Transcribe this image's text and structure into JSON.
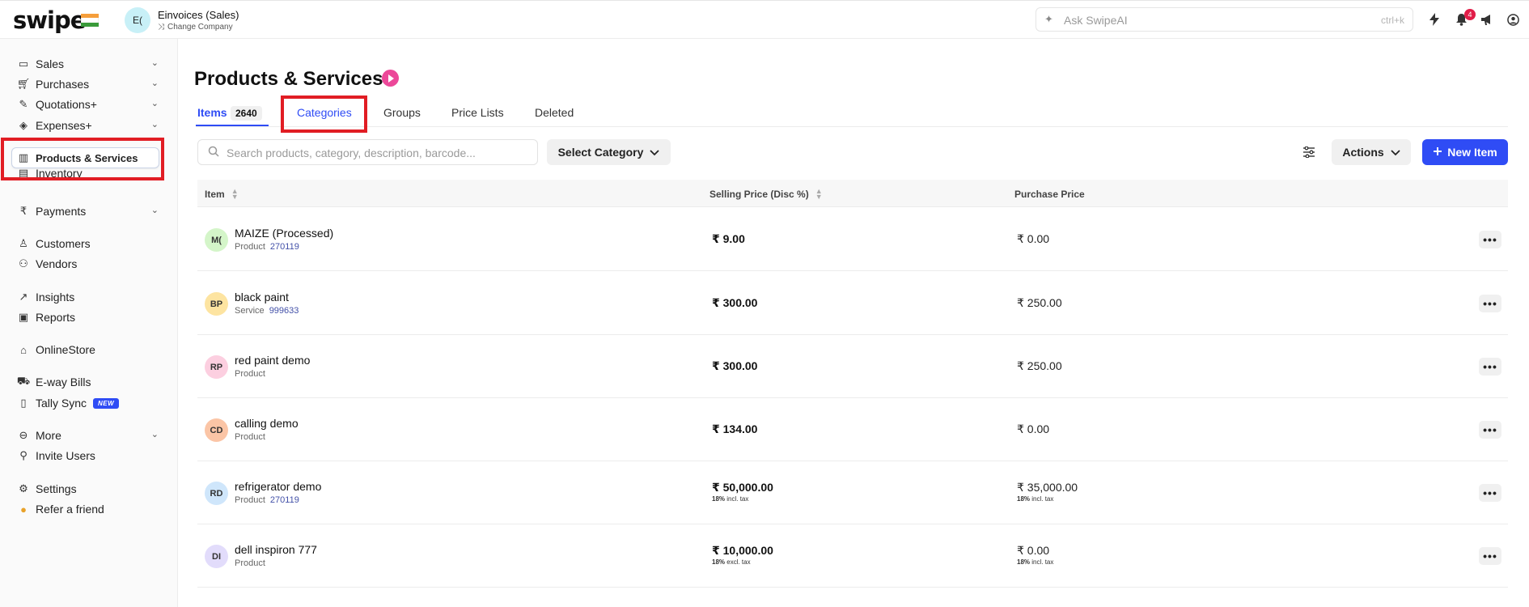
{
  "header": {
    "logo": "swipe",
    "company_avatar": "E(",
    "company_name": "Einvoices (Sales)",
    "change_company": "Change Company",
    "ai_search_placeholder": "Ask SwipeAI",
    "ai_search_shortcut": "ctrl+k",
    "notification_count": "4"
  },
  "sidebar": {
    "items": [
      {
        "label": "Sales",
        "icon": "cash-icon",
        "has_chevron": true
      },
      {
        "label": "Purchases",
        "icon": "cart-icon",
        "has_chevron": true
      },
      {
        "label": "Quotations+",
        "icon": "pen-icon",
        "has_chevron": true
      },
      {
        "label": "Expenses+",
        "icon": "tag-icon",
        "has_chevron": true
      },
      {
        "label": "Products & Services",
        "icon": "barcode-icon",
        "active": true
      },
      {
        "label": "Inventory",
        "icon": "chart-icon"
      },
      {
        "label": "Payments",
        "icon": "rupee-icon",
        "has_chevron": true
      },
      {
        "label": "Customers",
        "icon": "user-icon"
      },
      {
        "label": "Vendors",
        "icon": "users-icon"
      },
      {
        "label": "Insights",
        "icon": "trend-icon"
      },
      {
        "label": "Reports",
        "icon": "report-icon"
      },
      {
        "label": "OnlineStore",
        "icon": "store-icon"
      },
      {
        "label": "E-way Bills",
        "icon": "truck-icon"
      },
      {
        "label": "Tally Sync",
        "icon": "document-icon",
        "badge": "NEW"
      },
      {
        "label": "More",
        "icon": "more-circle-icon",
        "has_chevron": true
      },
      {
        "label": "Invite Users",
        "icon": "user-plus-icon"
      },
      {
        "label": "Settings",
        "icon": "gear-icon"
      },
      {
        "label": "Refer a friend",
        "icon": "handshake-icon"
      }
    ]
  },
  "main": {
    "title": "Products & Services",
    "tabs": [
      {
        "label": "Items",
        "count": "2640",
        "active": true
      },
      {
        "label": "Categories"
      },
      {
        "label": "Groups"
      },
      {
        "label": "Price Lists"
      },
      {
        "label": "Deleted"
      }
    ],
    "search_placeholder": "Search products, category, description, barcode...",
    "select_category": "Select Category",
    "actions": "Actions",
    "new_item": "New Item",
    "columns": {
      "item": "Item",
      "selling_price": "Selling Price (Disc %)",
      "purchase_price": "Purchase Price"
    },
    "rows": [
      {
        "initials": "M(",
        "avatar_color": "#d4f5c9",
        "name": "MAIZE (Processed)",
        "type": "Product",
        "code": "270119",
        "selling": "₹ 9.00",
        "selling_note": "",
        "purchase": "₹ 0.00",
        "purchase_note": ""
      },
      {
        "initials": "BP",
        "avatar_color": "#fde4a1",
        "name": "black paint",
        "type": "Service",
        "code": "999633",
        "selling": "₹ 300.00",
        "selling_note": "",
        "purchase": "₹ 250.00",
        "purchase_note": ""
      },
      {
        "initials": "RP",
        "avatar_color": "#fccfe0",
        "name": "red paint demo",
        "type": "Product",
        "code": "",
        "selling": "₹ 300.00",
        "selling_note": "",
        "purchase": "₹ 250.00",
        "purchase_note": ""
      },
      {
        "initials": "CD",
        "avatar_color": "#fbc5a6",
        "name": "calling demo",
        "type": "Product",
        "code": "",
        "selling": "₹ 134.00",
        "selling_note": "",
        "purchase": "₹ 0.00",
        "purchase_note": ""
      },
      {
        "initials": "RD",
        "avatar_color": "#cfe6fb",
        "name": "refrigerator demo",
        "type": "Product",
        "code": "270119",
        "selling": "₹ 50,000.00",
        "selling_note_pct": "18%",
        "selling_note": "incl. tax",
        "purchase": "₹ 35,000.00",
        "purchase_note_pct": "18%",
        "purchase_note": "incl. tax"
      },
      {
        "initials": "DI",
        "avatar_color": "#e2dcfb",
        "name": "dell inspiron 777",
        "type": "Product",
        "code": "",
        "selling": "₹ 10,000.00",
        "selling_note_pct": "18%",
        "selling_note": "excl. tax",
        "purchase": "₹ 0.00",
        "purchase_note_pct": "18%",
        "purchase_note": "incl. tax"
      }
    ]
  },
  "colors": {
    "accent": "#2f4cf5",
    "highlight": "#e11d24",
    "play": "#ec4899"
  }
}
